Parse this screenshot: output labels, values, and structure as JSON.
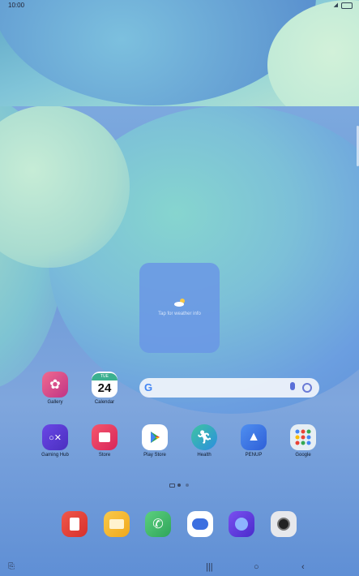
{
  "status": {
    "time": "10:00"
  },
  "weather": {
    "text": "Tap for weather info"
  },
  "calendar": {
    "day": "TUE",
    "date": "24"
  },
  "row1": [
    {
      "label": "Gallery",
      "color": "#e64f7f"
    },
    {
      "label": "Calendar",
      "color": "#ffffff"
    }
  ],
  "row2": [
    {
      "label": "Gaming Hub",
      "color": "#5b3bd8"
    },
    {
      "label": "Store",
      "color": "#e9345f"
    },
    {
      "label": "Play Store",
      "color": "#ffffff"
    },
    {
      "label": "Health",
      "color": "#2fae88"
    },
    {
      "label": "PENUP",
      "color": "#3b76e6"
    },
    {
      "label": "Google",
      "color": "#e6eef4"
    }
  ],
  "dock": [
    {
      "icon": "notes-icon",
      "color": "#e6433b"
    },
    {
      "icon": "folder-icon",
      "color": "#f4b526"
    },
    {
      "icon": "phone-icon",
      "color": "#3fb56a"
    },
    {
      "icon": "messages-icon",
      "color": "#ffffff"
    },
    {
      "icon": "internet-icon",
      "color": "#6a3fe0"
    },
    {
      "icon": "camera-icon",
      "color": "#e7e8ec"
    }
  ]
}
